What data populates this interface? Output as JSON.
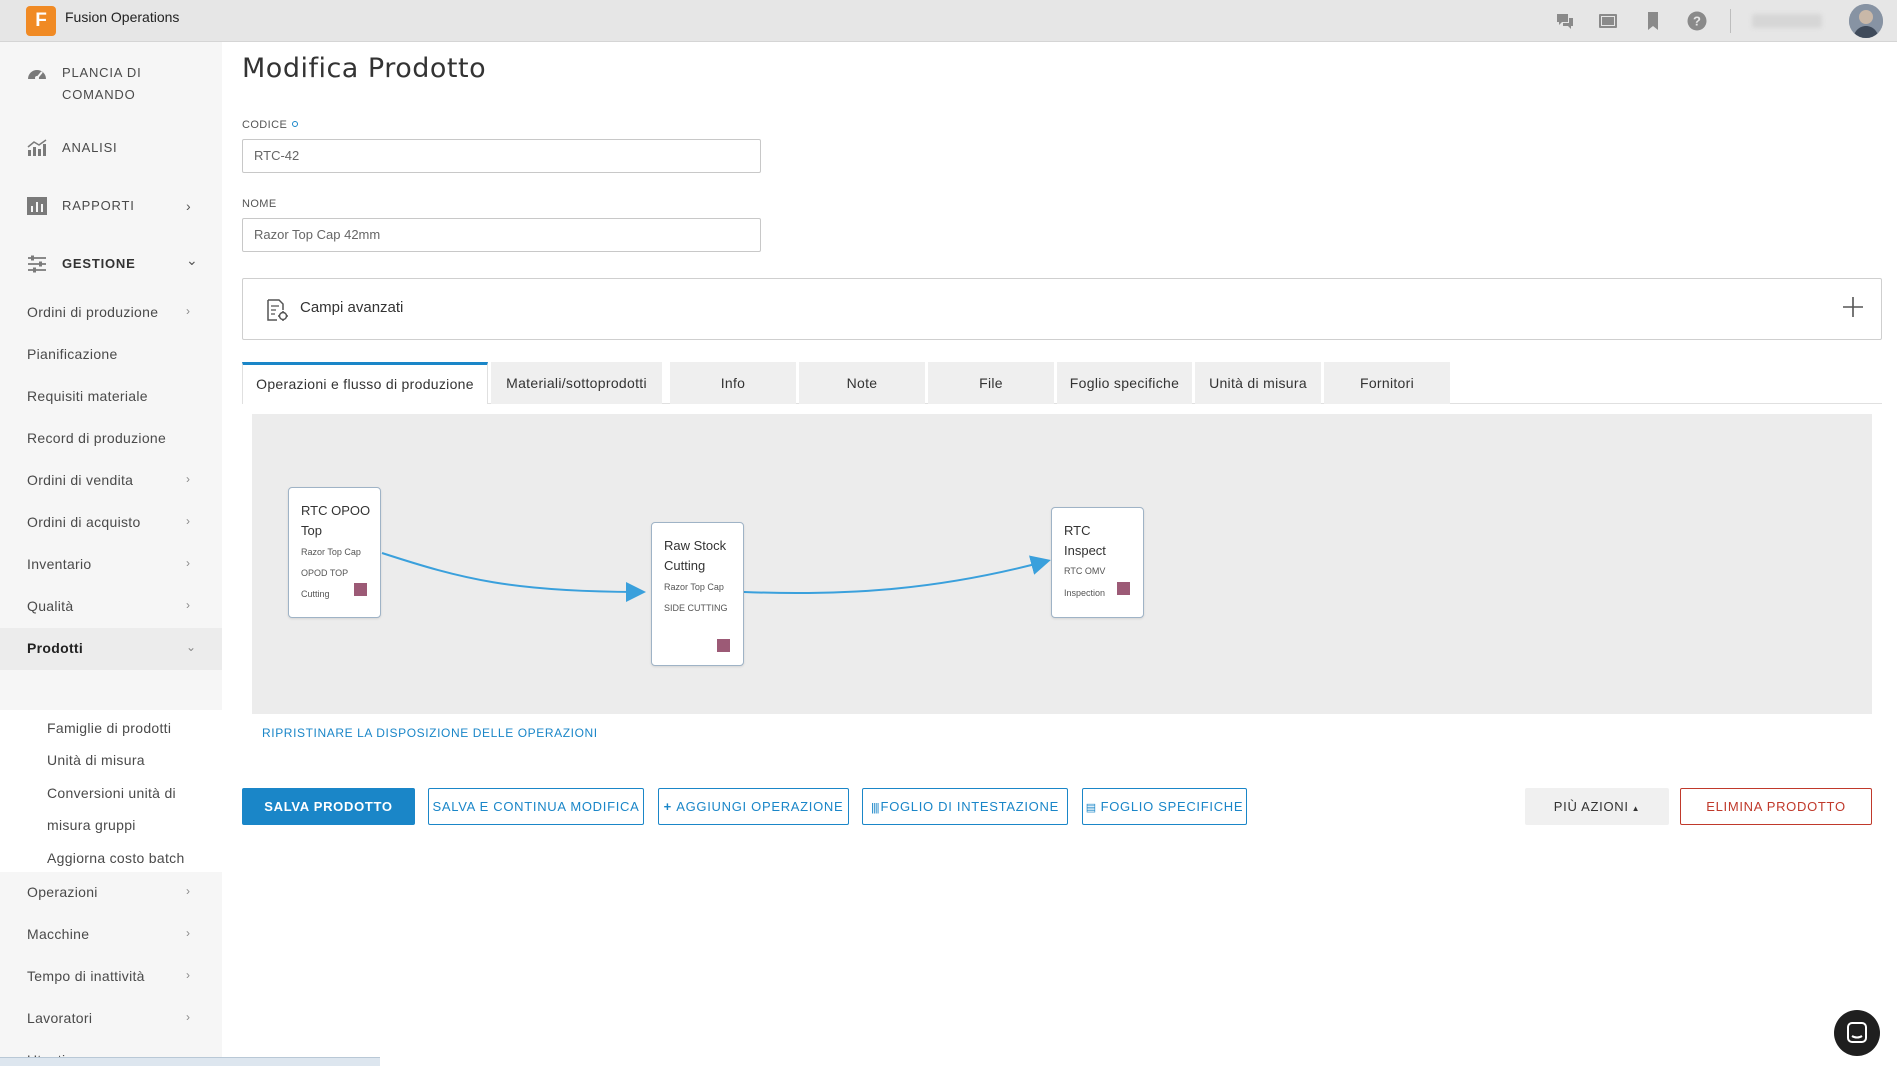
{
  "app": {
    "logo_letter": "F",
    "title": "Fusion Operations"
  },
  "topbar": {
    "icons": [
      "chat-icon",
      "video-icon",
      "bookmark-icon",
      "help-icon"
    ],
    "avatar": "user-avatar"
  },
  "sidebar": {
    "main": [
      {
        "label": "PLANCIA DI COMANDO",
        "icon": "dashboard-icon"
      },
      {
        "label": "ANALISI",
        "icon": "analytics-icon"
      },
      {
        "label": "RAPPORTI",
        "icon": "reports-icon",
        "chevron": "›"
      },
      {
        "label": "GESTIONE",
        "icon": "sliders-icon",
        "chevron": "⌄"
      }
    ],
    "items": [
      {
        "label": "Ordini di produzione",
        "chevron": "›"
      },
      {
        "label": "Pianificazione",
        "chevron": ""
      },
      {
        "label": "Requisiti materiale",
        "chevron": ""
      },
      {
        "label": "Record di produzione",
        "chevron": ""
      },
      {
        "label": "Ordini di vendita",
        "chevron": "›"
      },
      {
        "label": "Ordini di acquisto",
        "chevron": "›"
      },
      {
        "label": "Inventario",
        "chevron": "›"
      },
      {
        "label": "Qualità",
        "chevron": "›"
      },
      {
        "label": "Prodotti",
        "chevron": "⌄"
      }
    ],
    "sub_items": [
      "Famiglie di prodotti",
      "Unità di misura",
      "Conversioni unità di",
      "misura gruppi",
      "Aggiorna costo batch"
    ],
    "items_after": [
      {
        "label": "Operazioni",
        "chevron": "›"
      },
      {
        "label": "Macchine",
        "chevron": "›"
      },
      {
        "label": "Tempo di inattività",
        "chevron": "›"
      },
      {
        "label": "Lavoratori",
        "chevron": "›"
      },
      {
        "label": "Utenti",
        "chevron": "›"
      }
    ]
  },
  "page": {
    "title": "Modifica Prodotto",
    "code_label": "CODICE",
    "code_value": "RTC-42",
    "name_label": "NOME",
    "name_value": "Razor Top Cap 42mm",
    "advanced_label": "Campi avanzati"
  },
  "tabs": [
    "Operazioni e flusso di produzione",
    "Materiali/sottoprodotti",
    "Info",
    "Note",
    "File",
    "Foglio specifiche",
    "Unità di misura",
    "Fornitori"
  ],
  "flow": {
    "nodes": [
      {
        "title": "RTC OPOO Top",
        "line1": "Razor Top Cap",
        "line2": "OPOD TOP",
        "line3": "Cutting"
      },
      {
        "title": "Raw Stock Cutting",
        "line1": "Razor Top Cap",
        "line2": "SIDE CUTTING",
        "line3": ""
      },
      {
        "title": "RTC Inspect",
        "line1": "RTC OMV",
        "line2": "Inspection",
        "line3": ""
      }
    ],
    "status_color": "#9c5a76",
    "arrow_color": "#3aa0dc",
    "reset_label": "RIPRISTINARE LA DISPOSIZIONE DELLE OPERAZIONI"
  },
  "actions": {
    "save": "SALVA PRODOTTO",
    "save_continue": "SALVA E CONTINUA MODIFICA",
    "add_operation": "AGGIUNGI OPERAZIONE",
    "header_sheet": "FOGLIO DI INTESTAZIONE",
    "spec_sheet": "FOGLIO SPECIFICHE",
    "more": "PIÙ AZIONI",
    "delete": "ELIMINA PRODOTTO"
  },
  "colors": {
    "accent": "#1a86c8",
    "danger": "#c0392b",
    "brand": "#f08a24"
  }
}
